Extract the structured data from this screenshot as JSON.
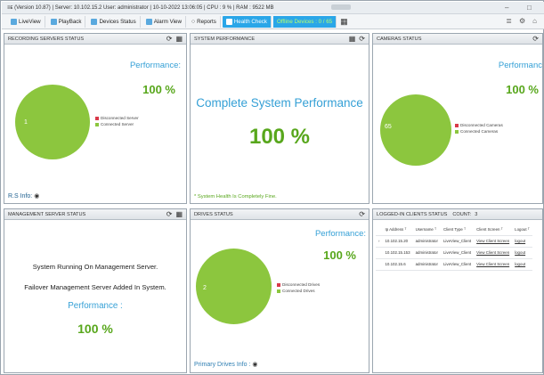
{
  "titlebar": {
    "text": "≡ᴇ (Version 10.87) | Server: 10.102.15.2 User: administrator | 10-10-2022 13:06:05 | CPU : 9 % | RAM : 9522 MB",
    "minimize": "–",
    "maximize": "□"
  },
  "menu": {
    "items": [
      "LiveView",
      "PlayBack",
      "Devices Status",
      "Alarm View",
      "Reports",
      "Health Check"
    ],
    "offline": "Offline Devices : 0 / 65",
    "active_index": 5,
    "right_icons": [
      "≣",
      "⚙",
      "⌂"
    ]
  },
  "colors": {
    "accent": "#2aa6e8",
    "pie_green": "#8cc63e",
    "disconnected_red": "#d93a4a",
    "perf_blue": "#35a0d6",
    "perf_green": "#58a71c"
  },
  "recording": {
    "header": "RECORDING SERVERS STATUS",
    "perf_label": "Performance:",
    "perf_value": "100 %",
    "count": "1",
    "legend": [
      "Disconnected Server",
      "Connected Server"
    ],
    "footer": "R.S Info:"
  },
  "system": {
    "header": "SYSTEM PERFORMANCE",
    "message": "Complete System Performance",
    "value": "100 %",
    "footer": "* System Health Is Completely Fine."
  },
  "cameras": {
    "header": "CAMERAS STATUS",
    "perf_label": "Performanc",
    "perf_value": "100 %",
    "count": "65",
    "legend": [
      "Disconnected Cameras",
      "Connected Cameras"
    ]
  },
  "management": {
    "header": "MANAGEMENT SERVER STATUS",
    "line1": "System Running On Management Server.",
    "line2": "Failover Management Server Added In System.",
    "perf_label": "Performance :",
    "perf_value": "100 %"
  },
  "drives": {
    "header": "DRIVES STATUS",
    "perf_label": "Performance:",
    "perf_value": "100 %",
    "count": "2",
    "legend": [
      "Disconnected Drives",
      "Connected Drives"
    ],
    "footer": "Primary Drives Info :"
  },
  "clients": {
    "header": "LOGGED-IN CLIENTS STATUS",
    "count_label": "COUNT:",
    "count": "3",
    "columns": [
      "Ip Address",
      "Username",
      "Client Type",
      "Client Screen",
      "Logout"
    ],
    "rows": [
      [
        "10.102.15.20",
        "administrator",
        "LiveView_Client",
        "View Client Screen",
        "logout"
      ],
      [
        "10.102.15.153",
        "administrator",
        "LiveView_Client",
        "View Client Screen",
        "logout"
      ],
      [
        "10.102.15.6",
        "administrator",
        "LiveView_Client",
        "View Client Screen",
        "logout"
      ]
    ]
  }
}
